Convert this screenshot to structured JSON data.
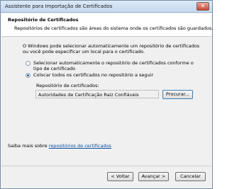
{
  "window": {
    "title": "Assistente para Importação de Certificados",
    "close_glyph": "✕"
  },
  "header": {
    "title": "Repositório de Certificados",
    "description": "Repositórios de certificados são áreas do sistema onde os certificados são guardados."
  },
  "content": {
    "intro": "O Windows pode selecionar automaticamente um repositório de certificados ou você pode especificar um local para o certificado.",
    "options": [
      {
        "label": "Selecionar automaticamente o repositório de certificados conforme o tipo de certificado",
        "selected": false
      },
      {
        "label": "Colocar todos os certificados no repositório a seguir",
        "selected": true
      }
    ],
    "store_label": "Repositório de certificados:",
    "store_value": "Autoridades de Certificação Raiz Confiáveis",
    "browse_button": "Procurar...",
    "learn_more_prefix": "Saiba mais sobre ",
    "learn_more_link": "repositórios de certificados"
  },
  "footer": {
    "back_button": "< Voltar",
    "next_button": "Avançar >",
    "cancel_button": "Cancelar"
  }
}
